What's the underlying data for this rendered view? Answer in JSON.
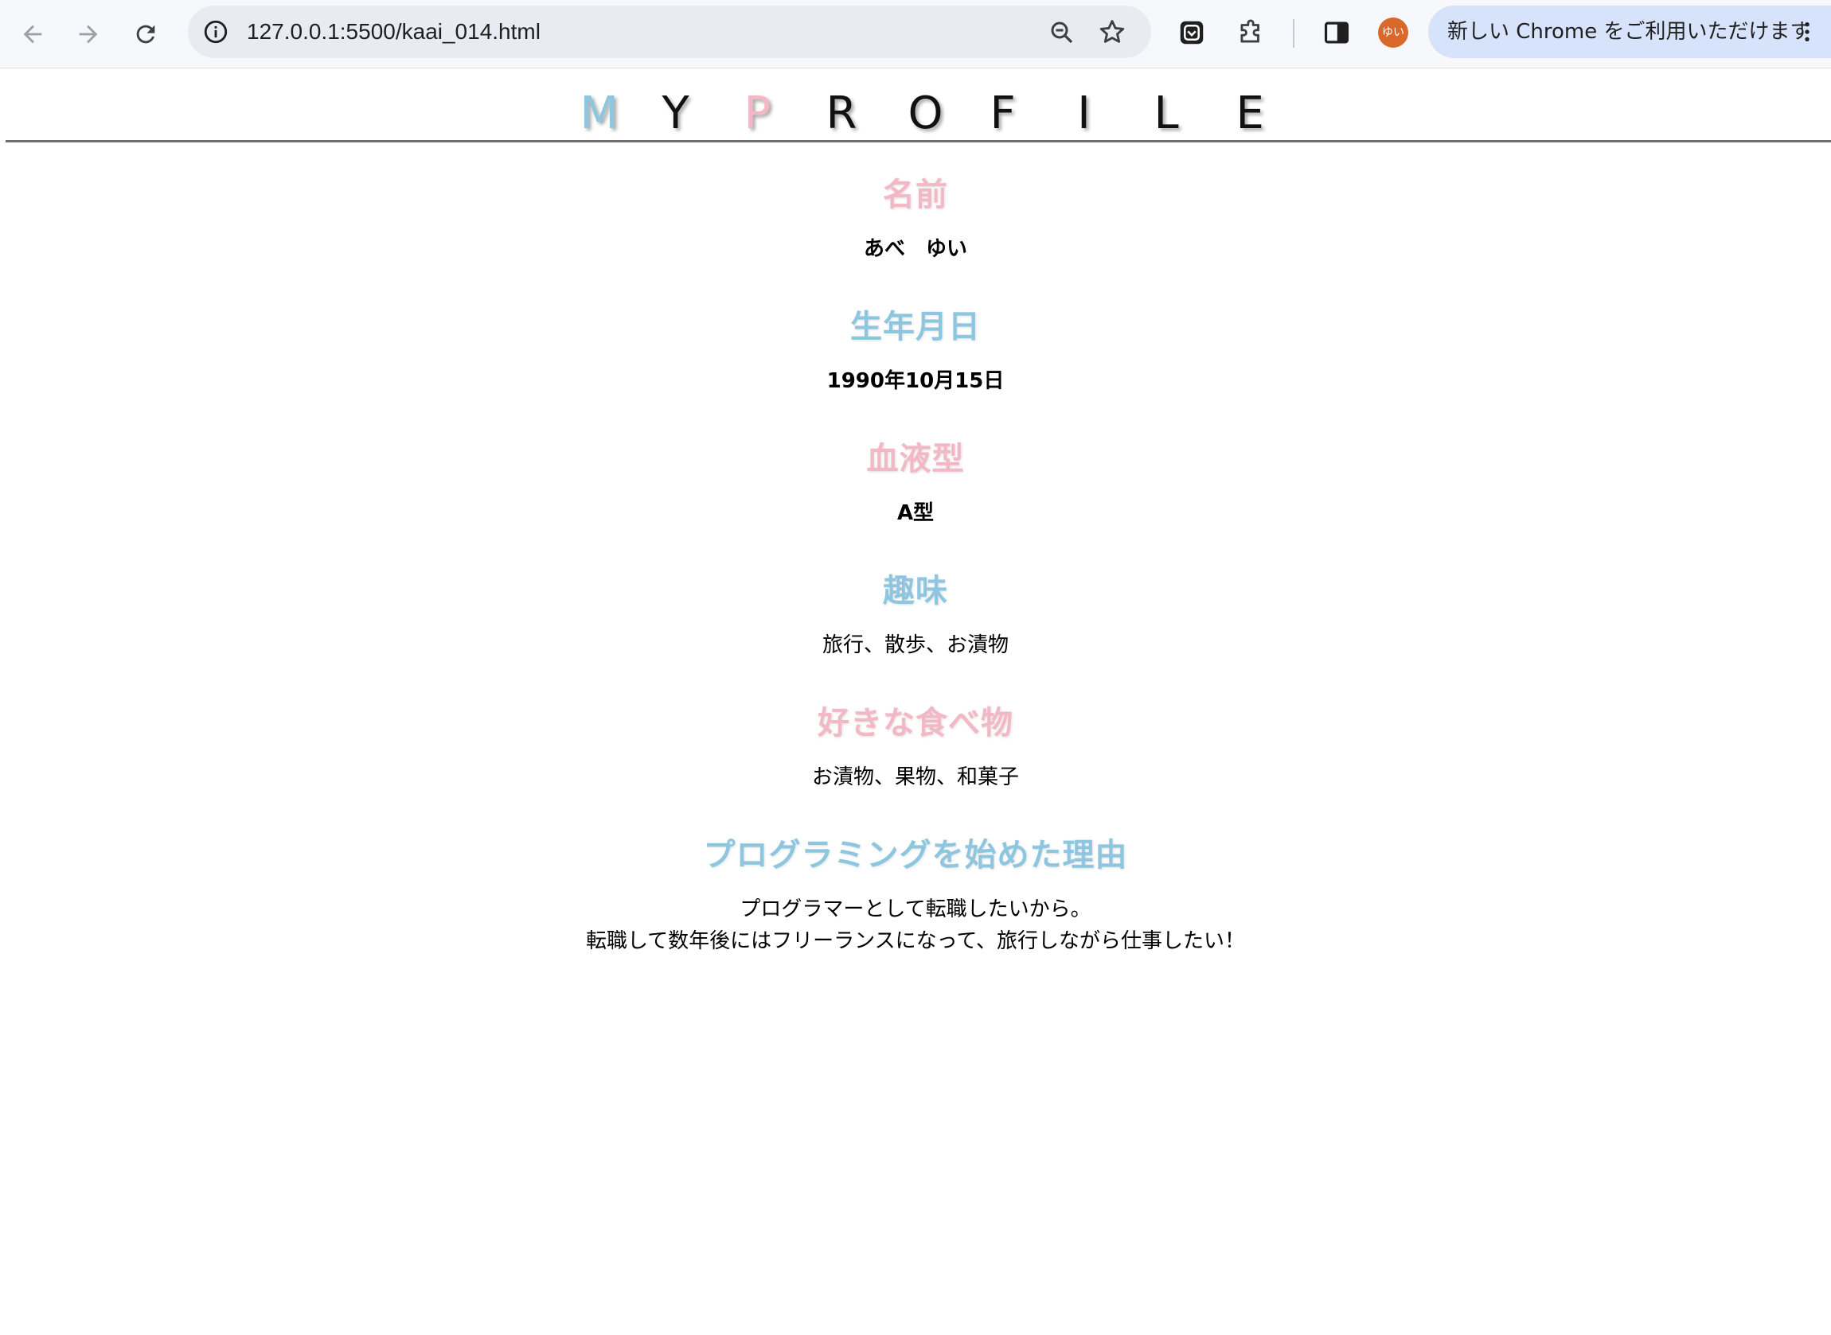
{
  "browser": {
    "url": "127.0.0.1:5500/kaai_014.html",
    "profile_initials": "ゆい",
    "update_label": "新しい Chrome をご利用いただけます"
  },
  "colors": {
    "blue": "#8ec6e0",
    "pink": "#f2b8c6",
    "text": "#000000"
  },
  "profile": {
    "title_letters": [
      {
        "char": "M",
        "color": "#8ec6e0"
      },
      {
        "char": "Y",
        "color": "#111111"
      },
      {
        "char": "P",
        "color": "#f2b8c6"
      },
      {
        "char": "R",
        "color": "#111111"
      },
      {
        "char": "O",
        "color": "#111111"
      },
      {
        "char": "F",
        "color": "#111111"
      },
      {
        "char": "I",
        "color": "#111111"
      },
      {
        "char": "L",
        "color": "#111111"
      },
      {
        "char": "E",
        "color": "#111111"
      }
    ],
    "sections": [
      {
        "heading": "名前",
        "heading_color": "pink",
        "value": "あべ　ゆい",
        "bold": true
      },
      {
        "heading": "生年月日",
        "heading_color": "blue",
        "value": "1990年10月15日",
        "bold": true
      },
      {
        "heading": "血液型",
        "heading_color": "pink",
        "value": "A型",
        "bold": true
      },
      {
        "heading": "趣味",
        "heading_color": "blue",
        "value": "旅行、散歩、お漬物",
        "bold": false
      },
      {
        "heading": "好きな食べ物",
        "heading_color": "pink",
        "value": "お漬物、果物、和菓子",
        "bold": false
      },
      {
        "heading": "プログラミングを始めた理由",
        "heading_color": "blue",
        "value": "プログラマーとして転職したいから。",
        "value2": "転職して数年後にはフリーランスになって、旅行しながら仕事したい！",
        "bold": false
      }
    ]
  }
}
